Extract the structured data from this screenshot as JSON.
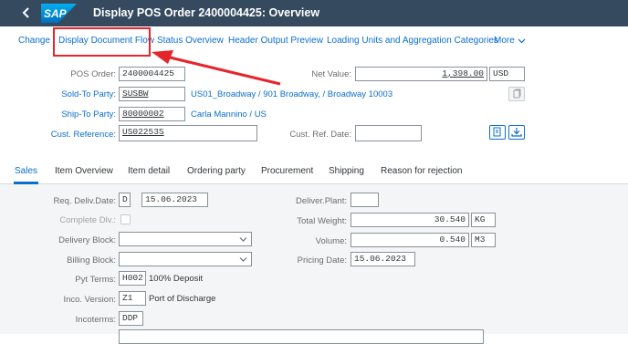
{
  "shell": {
    "logo_text": "SAP",
    "title": "Display POS Order 2400004425: Overview"
  },
  "toolbar": {
    "change": "Change",
    "display_document_flow": "Display Document Flow",
    "status_overview": "Status Overview",
    "header_output_preview": "Header Output Preview",
    "loading_units": "Loading Units and Aggregation Categories",
    "more": "More"
  },
  "header": {
    "pos_order_label": "POS Order:",
    "pos_order_value": "2400004425",
    "net_value_label": "Net Value:",
    "net_value": "1,398.00",
    "currency": "USD",
    "sold_to_label": "Sold-To Party:",
    "sold_to_value": "SUSBW",
    "sold_to_desc": "US01_Broadway / 901 Broadway, / Broadway 10003",
    "ship_to_label": "Ship-To Party:",
    "ship_to_value": "80000002",
    "ship_to_desc": "Carla Mannino / US",
    "cust_ref_label": "Cust. Reference:",
    "cust_ref_value": "US02253S",
    "cust_ref_date_label": "Cust. Ref. Date:",
    "cust_ref_date_value": ""
  },
  "tabs": [
    "Sales",
    "Item Overview",
    "Item detail",
    "Ordering party",
    "Procurement",
    "Shipping",
    "Reason for rejection"
  ],
  "active_tab": "Sales",
  "sales": {
    "req_deliv_label": "Req. Deliv.Date:",
    "req_deliv_type": "D",
    "req_deliv_date": "15.06.2023",
    "complete_dlv_label": "Complete Dlv.:",
    "delivery_block_label": "Delivery Block:",
    "delivery_block_value": "",
    "billing_block_label": "Billing Block:",
    "billing_block_value": "",
    "pyt_terms_label": "Pyt Terms:",
    "pyt_terms_code": "H002",
    "pyt_terms_desc": "100% Deposit",
    "inco_version_label": "Inco. Version:",
    "inco_version_code": "Z1",
    "inco_version_desc": "Port of Discharge",
    "incoterms_label": "Incoterms:",
    "incoterms_code": "DDP",
    "deliv_plant_label": "Deliver.Plant:",
    "deliv_plant_value": "",
    "total_weight_label": "Total Weight:",
    "total_weight_value": "30.540",
    "total_weight_unit": "KG",
    "volume_label": "Volume:",
    "volume_value": "0.540",
    "volume_unit": "M3",
    "pricing_date_label": "Pricing Date:",
    "pricing_date_value": "15.06.2023"
  },
  "colors": {
    "shell": "#354a5f",
    "link": "#0a6ed1",
    "annotation": "#e8242b"
  }
}
